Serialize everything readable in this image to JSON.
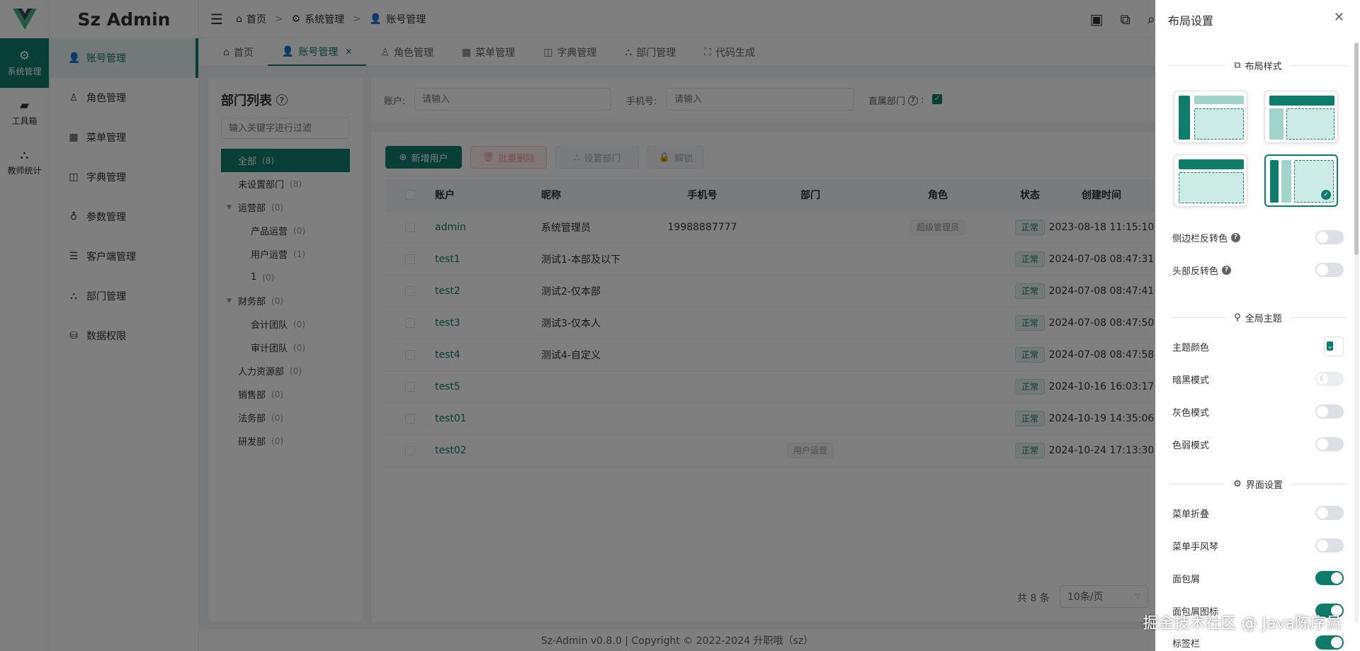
{
  "app": {
    "title": "Sz Admin"
  },
  "rail": {
    "items": [
      {
        "icon": "gear-icon",
        "label": "系统管理"
      },
      {
        "icon": "toolbox-icon",
        "label": "工具箱"
      },
      {
        "icon": "sitemap-icon",
        "label": "教师统计"
      }
    ]
  },
  "submenu": {
    "items": [
      {
        "icon": "user-icon",
        "label": "账号管理"
      },
      {
        "icon": "user-outline-icon",
        "label": "角色管理"
      },
      {
        "icon": "grid-icon",
        "label": "菜单管理"
      },
      {
        "icon": "book-icon",
        "label": "字典管理"
      },
      {
        "icon": "param-icon",
        "label": "参数管理"
      },
      {
        "icon": "sliders-icon",
        "label": "客户端管理"
      },
      {
        "icon": "sitemap-icon",
        "label": "部门管理"
      },
      {
        "icon": "db-icon",
        "label": "数据权限"
      }
    ]
  },
  "breadcrumb": {
    "items": [
      "首页",
      "系统管理",
      "账号管理"
    ]
  },
  "tabs": [
    {
      "label": "首页"
    },
    {
      "label": "账号管理"
    },
    {
      "label": "角色管理"
    },
    {
      "label": "菜单管理"
    },
    {
      "label": "字典管理"
    },
    {
      "label": "部门管理"
    },
    {
      "label": "代码生成"
    }
  ],
  "dept": {
    "title": "部门列表",
    "search_placeholder": "输入关键字进行过滤",
    "nodes": [
      {
        "label": "全部",
        "count": "(8)"
      },
      {
        "label": "未设置部门",
        "count": "(8)"
      },
      {
        "label": "运营部",
        "count": "(0)"
      },
      {
        "label": "产品运营",
        "count": "(0)"
      },
      {
        "label": "用户运营",
        "count": "(1)"
      },
      {
        "label": "1",
        "count": "(0)"
      },
      {
        "label": "财务部",
        "count": "(0)"
      },
      {
        "label": "会计团队",
        "count": "(0)"
      },
      {
        "label": "审计团队",
        "count": "(0)"
      },
      {
        "label": "人力资源部",
        "count": "(0)"
      },
      {
        "label": "销售部",
        "count": "(0)"
      },
      {
        "label": "法务部",
        "count": "(0)"
      },
      {
        "label": "研发部",
        "count": "(0)"
      }
    ]
  },
  "filters": {
    "account_label": "账户:",
    "account_placeholder": "请输入",
    "phone_label": "手机号:",
    "phone_placeholder": "请输入",
    "direct_label": "直属部门"
  },
  "actions": {
    "add": "新增用户",
    "batch_delete": "批量删除",
    "set_dept": "设置部门",
    "unlock": "解锁"
  },
  "table": {
    "headers": [
      "账户",
      "昵称",
      "手机号",
      "部门",
      "角色",
      "状态",
      "创建时间"
    ],
    "rows": [
      {
        "account": "admin",
        "nickname": "系统管理员",
        "phone": "19988887777",
        "dept": "",
        "role": "超级管理员",
        "status": "正常",
        "created": "2023-08-18 11:15:10"
      },
      {
        "account": "test1",
        "nickname": "测试1-本部及以下",
        "phone": "",
        "dept": "",
        "role": "",
        "status": "正常",
        "created": "2024-07-08 08:47:31"
      },
      {
        "account": "test2",
        "nickname": "测试2-仅本部",
        "phone": "",
        "dept": "",
        "role": "",
        "status": "正常",
        "created": "2024-07-08 08:47:41"
      },
      {
        "account": "test3",
        "nickname": "测试3-仅本人",
        "phone": "",
        "dept": "",
        "role": "",
        "status": "正常",
        "created": "2024-07-08 08:47:50"
      },
      {
        "account": "test4",
        "nickname": "测试4-自定义",
        "phone": "",
        "dept": "",
        "role": "",
        "status": "正常",
        "created": "2024-07-08 08:47:58"
      },
      {
        "account": "test5",
        "nickname": "",
        "phone": "",
        "dept": "",
        "role": "",
        "status": "正常",
        "created": "2024-10-16 16:03:17"
      },
      {
        "account": "test01",
        "nickname": "",
        "phone": "",
        "dept": "",
        "role": "",
        "status": "正常",
        "created": "2024-10-19 14:35:06"
      },
      {
        "account": "test02",
        "nickname": "",
        "phone": "",
        "dept": "用户运营",
        "role": "",
        "status": "正常",
        "created": "2024-10-24 17:13:30"
      }
    ]
  },
  "pagination": {
    "total": "共 8 条",
    "page_size": "10条/页"
  },
  "footer": {
    "text": "Sz-Admin v0.8.0 | Copyright © 2022-2024 升职哦（sz）"
  },
  "drawer": {
    "title": "布局设置",
    "section_layout": "布局样式",
    "section_theme": "全局主题",
    "section_ui": "界面设置",
    "settings": {
      "sidebar_invert": "侧边栏反转色",
      "header_invert": "头部反转色",
      "theme_color": "主题颜色",
      "dark_mode": "暗黑模式",
      "gray_mode": "灰色模式",
      "weak_mode": "色弱模式",
      "collapse": "菜单折叠",
      "accordion": "菜单手风琴",
      "breadcrumb": "面包屑",
      "breadcrumb_icon": "面包屑图标",
      "tabs": "标签栏"
    }
  },
  "colors": {
    "primary": "#0e7c6b"
  },
  "watermark": "掘金技术社区 @ Java陈序员"
}
